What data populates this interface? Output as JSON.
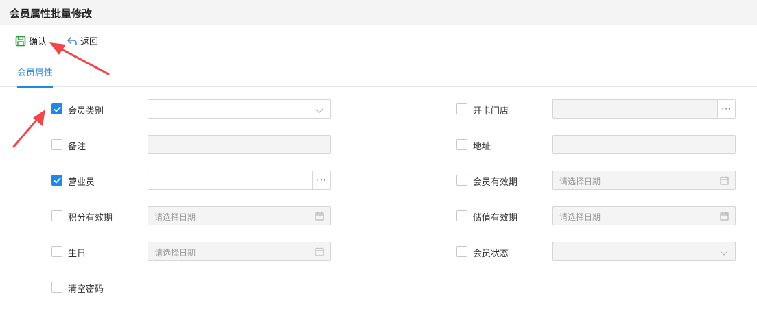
{
  "window": {
    "title": "会员属性批量修改"
  },
  "toolbar": {
    "confirm_label": "确认",
    "back_label": "返回"
  },
  "tabs": [
    {
      "label": "会员属性"
    }
  ],
  "left_fields": [
    {
      "label": "会员类别",
      "checked": true,
      "type": "select",
      "placeholder": "",
      "enabled": true
    },
    {
      "label": "备注",
      "checked": false,
      "type": "text",
      "placeholder": "",
      "enabled": false
    },
    {
      "label": "营业员",
      "checked": true,
      "type": "lookup",
      "placeholder": "",
      "enabled": true
    },
    {
      "label": "积分有效期",
      "checked": false,
      "type": "date",
      "placeholder": "请选择日期",
      "enabled": false
    },
    {
      "label": "生日",
      "checked": false,
      "type": "date",
      "placeholder": "请选择日期",
      "enabled": false
    },
    {
      "label": "清空密码",
      "checked": false,
      "type": "none",
      "placeholder": "",
      "enabled": false
    }
  ],
  "right_fields": [
    {
      "label": "开卡门店",
      "checked": false,
      "type": "lookup",
      "placeholder": "",
      "enabled": false
    },
    {
      "label": "地址",
      "checked": false,
      "type": "text",
      "placeholder": "",
      "enabled": false
    },
    {
      "label": "会员有效期",
      "checked": false,
      "type": "date",
      "placeholder": "请选择日期",
      "enabled": false
    },
    {
      "label": "储值有效期",
      "checked": false,
      "type": "date",
      "placeholder": "请选择日期",
      "enabled": false
    },
    {
      "label": "会员状态",
      "checked": false,
      "type": "select",
      "placeholder": "",
      "enabled": false
    }
  ],
  "colors": {
    "accent": "#1e88e5",
    "save_icon": "#2e9d3c",
    "annotation": "#f0474b"
  },
  "icons": {
    "confirm": "save-icon",
    "back": "undo-arrow-icon",
    "select": "chevron-down-icon",
    "date": "calendar-icon",
    "lookup": "ellipsis-icon",
    "check": "checkmark-icon"
  }
}
